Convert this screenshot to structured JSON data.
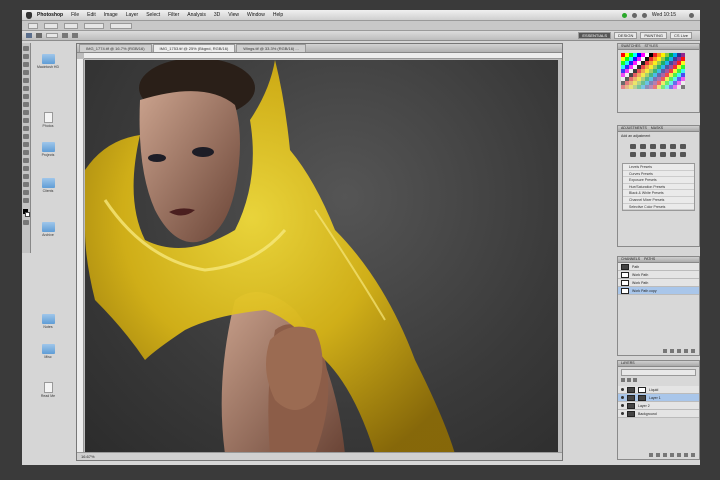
{
  "menubar": {
    "app_name": "Photoshop",
    "items": [
      "File",
      "Edit",
      "Image",
      "Layer",
      "Select",
      "Filter",
      "Analysis",
      "3D",
      "View",
      "Window",
      "Help"
    ],
    "clock": "Wed 10:15"
  },
  "workspace": {
    "essentials": "ESSENTIALS",
    "design": "DESIGN",
    "painting": "PAINTING",
    "cs_live": "CS Live"
  },
  "document": {
    "tab_1": "IMG_1774.tif @ 16.7% (RGB/16)",
    "tab_2": "IMG_1753.tif @ 25% (Bkgnd, RGB/16)",
    "tab_3": "Wings.tif @ 33.3% (RGB/16) ...",
    "status": "16.67%"
  },
  "panels": {
    "swatches_tab": "SWATCHES",
    "styles_tab": "STYLES",
    "adjustments_tab": "ADJUSTMENTS",
    "masks_tab": "MASKS",
    "adjustments_hint": "Add an adjustment",
    "channels_tab": "CHANNELS",
    "paths_tab": "PATHS",
    "layers_tab": "LAYERS",
    "adjustment_presets": [
      "Levels Presets",
      "Curves Presets",
      "Exposure Presets",
      "Hue/Saturation Presets",
      "Black & White Presets",
      "Channel Mixer Presets",
      "Selective Color Presets"
    ],
    "path_rows": [
      "Path",
      "Work Path",
      "Work Path copy"
    ],
    "layer_rows": [
      "Liquid",
      "Layer 1",
      "Layer 2",
      "Background"
    ]
  },
  "desktop_icons": [
    "Macintosh HD",
    "Photos",
    "Projects",
    "Clients",
    "Archive",
    "Notes",
    "Misc",
    "Read Me"
  ],
  "colors": {
    "selection": "#a9c6ea",
    "menu": "#f0f0f0",
    "canvas_bg": "#3a3a3a",
    "liquid_yellow": "#e3c11a"
  }
}
